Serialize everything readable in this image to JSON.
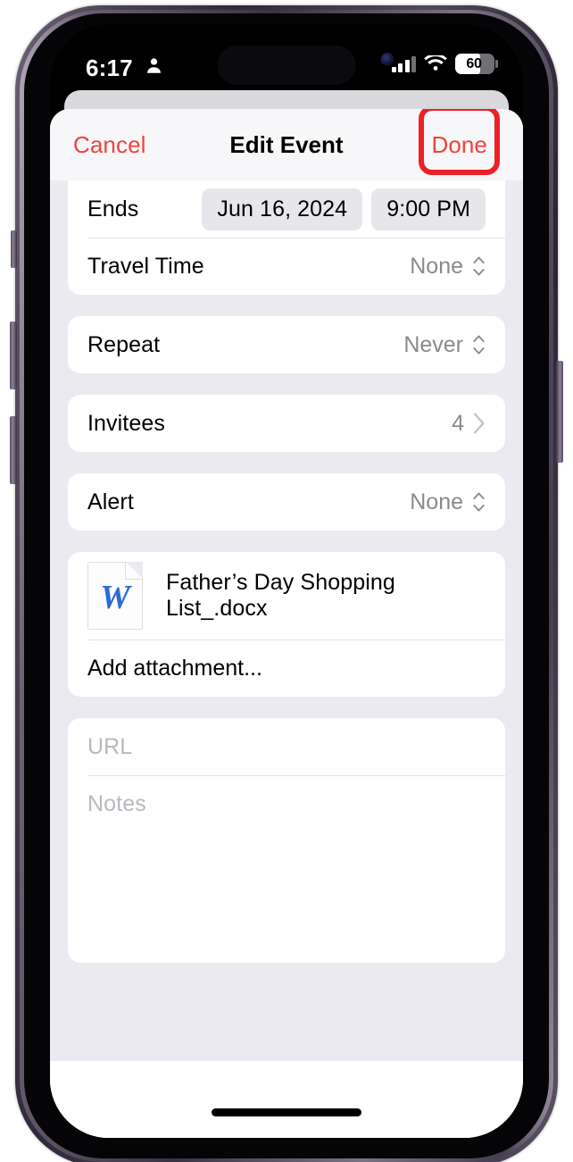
{
  "status_bar": {
    "time": "6:17",
    "person_icon": "person-icon",
    "signal_icon": "cellular-signal-icon",
    "wifi_icon": "wifi-icon",
    "battery_level": "60"
  },
  "nav": {
    "cancel_label": "Cancel",
    "title": "Edit Event",
    "done_label": "Done",
    "tint_color": "#f0433a",
    "highlight_color": "#ee1f27"
  },
  "form": {
    "ends": {
      "label": "Ends",
      "date": "Jun 16, 2024",
      "time": "9:00 PM"
    },
    "travel_time": {
      "label": "Travel Time",
      "value": "None"
    },
    "repeat": {
      "label": "Repeat",
      "value": "Never"
    },
    "invitees": {
      "label": "Invitees",
      "value": "4"
    },
    "alert": {
      "label": "Alert",
      "value": "None"
    },
    "attachment": {
      "file_name": "Father’s Day Shopping List_.docx",
      "file_icon": "word-document-icon",
      "file_icon_letter": "W",
      "add_label": "Add attachment..."
    },
    "url": {
      "placeholder": "URL",
      "value": ""
    },
    "notes": {
      "placeholder": "Notes",
      "value": ""
    }
  }
}
